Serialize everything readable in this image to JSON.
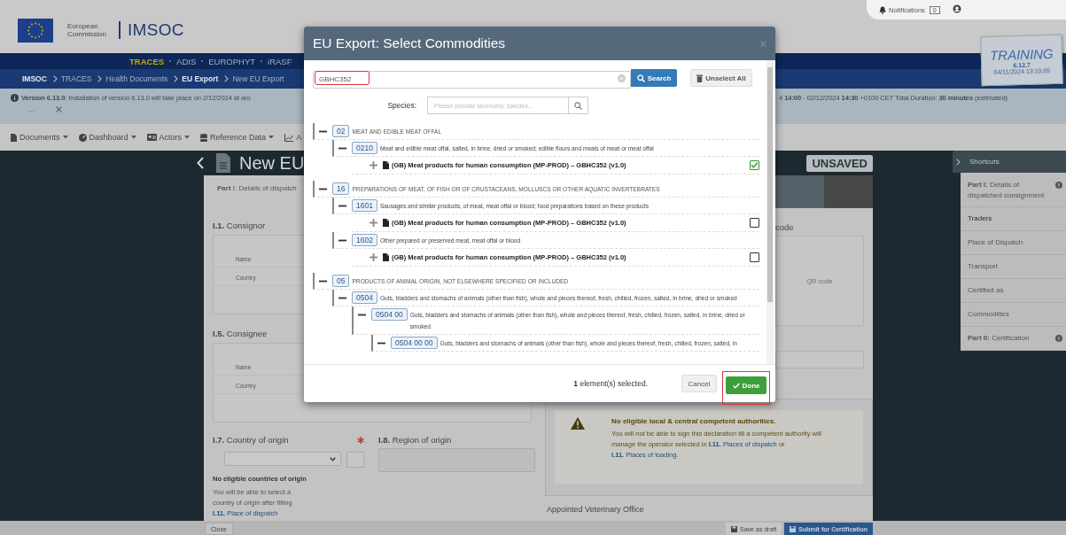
{
  "header": {
    "org_name": "European Commission",
    "app_name": "IMSOC",
    "notifications": {
      "label": "Notifications",
      "count": "0"
    },
    "environment": {
      "name": "TRAINING",
      "version": "6.12.7",
      "timestamp": "04/11/2024 13:10:05"
    }
  },
  "nav": [
    {
      "label": "TRACES",
      "selected": true
    },
    {
      "label": "ADIS",
      "selected": false
    },
    {
      "label": "EUROPHYT",
      "selected": false
    },
    {
      "label": "iRASF",
      "selected": false
    }
  ],
  "breadcrumb": [
    {
      "label": "IMSOC",
      "emphasized": true
    },
    {
      "label": "TRACES",
      "emphasized": false
    },
    {
      "label": "Health Documents",
      "emphasized": false
    },
    {
      "label": "EU Export",
      "emphasized": true
    },
    {
      "label": "New EU Export",
      "emphasized": false
    }
  ],
  "notice": {
    "left_text": "**Version 6.13.0**: Installation of version 6.13.0 will take place on 2/12/2024 at aro",
    "right_text": "4 **14:00** - 02/12/2024 **14:30** +0100 CET Total Duration: **30 minutes** (estimated)",
    "more": "..."
  },
  "menu": [
    {
      "kind": "file",
      "label": "Documents",
      "dropdown": true
    },
    {
      "kind": "dashboard",
      "label": "Dashboard",
      "dropdown": true
    },
    {
      "kind": "id-card",
      "label": "Actors",
      "dropdown": true
    },
    {
      "kind": "database",
      "label": "Reference Data",
      "dropdown": true
    },
    {
      "kind": "chart",
      "label": "A",
      "dropdown": false
    }
  ],
  "page": {
    "title": "New EU",
    "status": "UNSAVED",
    "part_tab": "**Part** I: Details of dispatch"
  },
  "form": {
    "consignor": {
      "label": "**I.1.** Consignor",
      "fields": [
        "Name",
        "Country"
      ]
    },
    "consignee": {
      "label": "**I.5.** Consignee",
      "fields": [
        "Name",
        "Country"
      ]
    },
    "country_of_origin": {
      "label": "**I.7.** Country of origin",
      "required": true,
      "warning_title": "No eligible countries of origin",
      "warning_text": [
        {
          "kind": "plain",
          "text": "You will be able to select a country of origin after filling "
        },
        {
          "kind": "link",
          "text": "**I.11.** Place of dispatch"
        }
      ]
    },
    "region_of_origin": {
      "label": "**I.8.** Region of origin"
    },
    "qr": {
      "label": "code",
      "placeholder": "QR code"
    },
    "authority_warning": {
      "title": "No eligible local & central competent authorities.",
      "text": [
        {
          "kind": "plain",
          "text": "You will not be able to sign this declaration till a competent authority will manage the operator selected in "
        },
        {
          "kind": "link",
          "text": "**I.11.** Places of dispatch"
        },
        {
          "kind": "plain",
          "text": " or "
        },
        {
          "kind": "link",
          "text": "**I.11.** Places of loading"
        },
        {
          "kind": "plain",
          "text": "."
        }
      ]
    },
    "veterinary_office": "Appointed Veterinary Office"
  },
  "shortcuts": {
    "title": "Shortcuts",
    "items": [
      {
        "label": "**Part I:** Details of dispatched consignment",
        "selected": false,
        "help": true
      },
      {
        "label": "Traders",
        "selected": true,
        "help": false
      },
      {
        "label": "Place of Dispatch",
        "selected": false,
        "help": false
      },
      {
        "label": "Transport",
        "selected": false,
        "help": false
      },
      {
        "label": "Certified as",
        "selected": false,
        "help": false
      },
      {
        "label": "Commodities",
        "selected": false,
        "help": false
      },
      {
        "label": "**Part II:** Certification",
        "selected": false,
        "help": true
      }
    ]
  },
  "footer": {
    "close": "Close",
    "save_draft": "Save as draft",
    "submit": "Submit for Certification"
  },
  "modal": {
    "title": "EU Export: Select Commodities",
    "search": {
      "value": "GBHC352",
      "highlighted": true,
      "button": "Search"
    },
    "unselect_button": "Unselect All",
    "species": {
      "label": "Species:",
      "placeholder": "Please provide taxonomy, species..."
    },
    "tree": [
      {
        "kind": "chapter",
        "code": "02",
        "label": "MEAT AND EDIBLE MEAT OFFAL",
        "expanded": true,
        "children": [
          {
            "kind": "heading",
            "code": "0210",
            "label": "Meat and edible meat offal, salted, in brine, dried or smoked; edible flours and meals of meat or meat offal",
            "expanded": true,
            "children": [
              {
                "kind": "certificate",
                "label": "(GB) Meat products for human consumption (MP-PROD) – GBHC352 (v1.0)",
                "expanded": false,
                "checked": true
              }
            ]
          }
        ]
      },
      {
        "kind": "chapter",
        "code": "16",
        "label": "PREPARATIONS OF MEAT, OF FISH OR OF CRUSTACEANS, MOLLUSCS OR OTHER AQUATIC INVERTEBRATES",
        "expanded": true,
        "children": [
          {
            "kind": "heading",
            "code": "1601",
            "label": "Sausages and similar products, of meat, meat offal or blood; food preparations based on these products",
            "expanded": true,
            "children": [
              {
                "kind": "certificate",
                "label": "(GB) Meat products for human consumption (MP-PROD) – GBHC352 (v1.0)",
                "expanded": false,
                "checked": false
              }
            ]
          },
          {
            "kind": "heading",
            "code": "1602",
            "label": "Other prepared or preserved meat, meat offal or blood",
            "expanded": true,
            "children": [
              {
                "kind": "certificate",
                "label": "(GB) Meat products for human consumption (MP-PROD) – GBHC352 (v1.0)",
                "expanded": false,
                "checked": false
              }
            ]
          }
        ]
      },
      {
        "kind": "chapter",
        "code": "05",
        "label": "PRODUCTS OF ANIMAL ORIGIN, NOT ELSEWHERE SPECIFIED OR INCLUDED",
        "expanded": true,
        "children": [
          {
            "kind": "heading",
            "code": "0504",
            "label": "Guts, bladders and stomachs of animals (other than fish), whole and pieces thereof, fresh, chilled, frozen, salted, in brine, dried or smoked",
            "expanded": true,
            "children": [
              {
                "kind": "heading",
                "code": "0504 00",
                "label": "Guts, bladders and stomachs of animals (other than fish), whole and pieces thereof, fresh, chilled, frozen, salted, in brine, dried or smoked",
                "expanded": true,
                "children": [
                  {
                    "kind": "heading",
                    "code": "0504 00 00",
                    "label": "Guts, bladders and stomachs of animals (other than fish), whole and pieces thereof, fresh, chilled, frozen, salted, in",
                    "expanded": true
                  }
                ]
              }
            ]
          }
        ]
      }
    ],
    "selection_count": "**1** element(s) selected.",
    "cancel": "Cancel",
    "done": {
      "label": "Done",
      "highlighted": true
    }
  }
}
